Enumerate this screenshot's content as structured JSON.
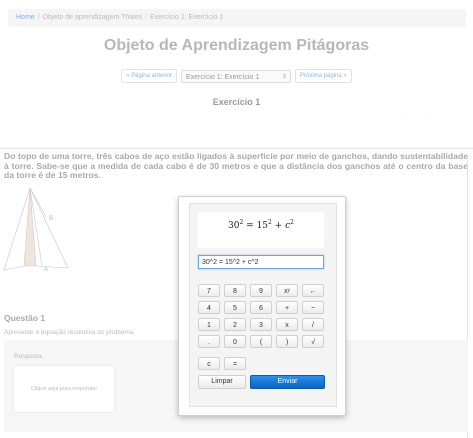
{
  "breadcrumb": {
    "home": "Home",
    "course": "Objeto de aprendizagem Thales",
    "current": "Exercício 1: Exercício 1"
  },
  "page_title": "Objeto de Aprendizagem Pitágoras",
  "pager": {
    "prev_label": "« Página anterior",
    "selected": "Exercício 1: Exercício 1",
    "next_label": "Próxima página »"
  },
  "exercise_label": "Exercício 1",
  "problem_text": "Do topo de uma torre, três cabos de aço estão ligados à superfície por meio de ganchos, dando sustentabilidade à torre. Sabe-se que a medida de cada cabo é de 30 metros e que a distância dos ganchos até o centro da base da torre é de 15 metros.",
  "figure": {
    "label_b": "B",
    "label_a": "A"
  },
  "question": {
    "title": "Questão 1",
    "description": "Apresente a equação resolutiva do problema.",
    "answer_label": "Resposta:",
    "answer_placeholder": "Clique aqui para responder"
  },
  "editor": {
    "preview": {
      "a": "30",
      "b": "15",
      "c": "c",
      "exp": "2"
    },
    "input_value": "30^2 = 15^2 + c^2",
    "keys": [
      [
        "7",
        "8",
        "9",
        "xʸ",
        "←"
      ],
      [
        "4",
        "5",
        "6",
        "+",
        "−"
      ],
      [
        "1",
        "2",
        "3",
        "x",
        "/"
      ],
      [
        ".",
        "0",
        "(",
        ")",
        "√"
      ],
      [
        "c",
        "="
      ]
    ],
    "clear_label": "Limpar",
    "submit_label": "Enviar",
    "accent_color": "#0a64c2"
  }
}
